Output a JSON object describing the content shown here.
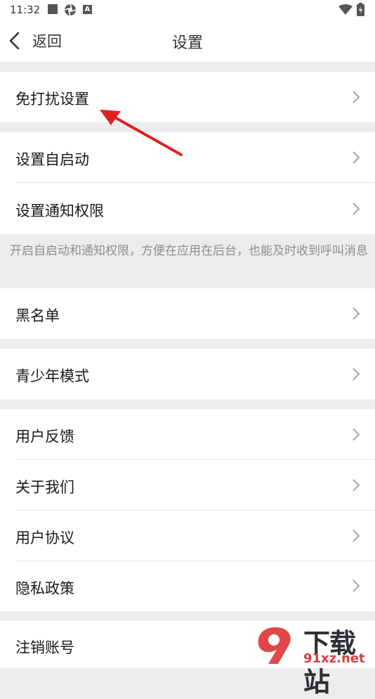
{
  "status_bar": {
    "time": "11:32"
  },
  "nav": {
    "back_label": "返回",
    "title": "设置"
  },
  "rows": [
    {
      "label": "免打扰设置"
    },
    {
      "label": "设置自启动"
    },
    {
      "label": "设置通知权限"
    },
    {
      "label": "黑名单"
    },
    {
      "label": "青少年模式"
    },
    {
      "label": "用户反馈"
    },
    {
      "label": "关于我们"
    },
    {
      "label": "用户协议"
    },
    {
      "label": "隐私政策"
    },
    {
      "label": "注销账号"
    }
  ],
  "note": {
    "text": "开启自启动和通知权限，方便在应用在后台，也能及时收到呼叫消息"
  },
  "annotation": {
    "arrow_color": "#e02020"
  },
  "watermark": {
    "brand": "下载站",
    "url": "91xz.net"
  }
}
